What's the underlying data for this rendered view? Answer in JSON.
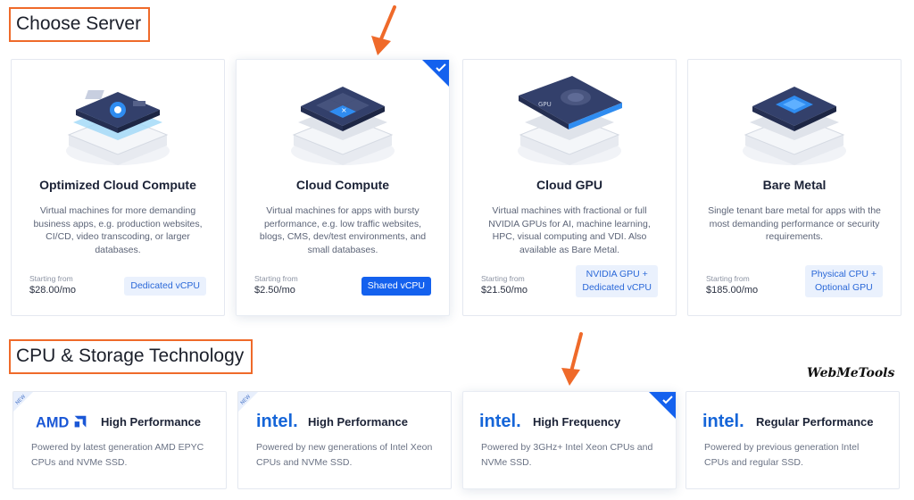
{
  "sections": {
    "server_title": "Choose Server",
    "cpu_title": "CPU & Storage Technology"
  },
  "servers": [
    {
      "name": "Optimized Cloud Compute",
      "description": "Virtual machines for more demanding business apps, e.g. production websites, CI/CD, video transcoding, or larger databases.",
      "price_label": "Starting from",
      "price": "$28.00/mo",
      "badge": "Dedicated vCPU",
      "icon": "optimized-compute-icon",
      "selected": false
    },
    {
      "name": "Cloud Compute",
      "description": "Virtual machines for apps with bursty performance, e.g. low traffic websites, blogs, CMS, dev/test environments, and small databases.",
      "price_label": "Starting from",
      "price": "$2.50/mo",
      "badge": "Shared vCPU",
      "icon": "cloud-compute-icon",
      "selected": true
    },
    {
      "name": "Cloud GPU",
      "description": "Virtual machines with fractional or full NVIDIA GPUs for AI, machine learning, HPC, visual computing and VDI. Also available as Bare Metal.",
      "price_label": "Starting from",
      "price": "$21.50/mo",
      "badge_line1": "NVIDIA GPU +",
      "badge_line2": "Dedicated vCPU",
      "icon": "gpu-icon",
      "selected": false
    },
    {
      "name": "Bare Metal",
      "description": "Single tenant bare metal for apps with the most demanding performance or security requirements.",
      "price_label": "Starting from",
      "price": "$185.00/mo",
      "badge_line1": "Physical CPU +",
      "badge_line2": "Optional GPU",
      "icon": "bare-metal-icon",
      "selected": false
    }
  ],
  "cpu_options": [
    {
      "brand": "AMD",
      "title": "High Performance",
      "description": "Powered by latest generation AMD EPYC CPUs and NVMe SSD.",
      "new_tag": "NEW",
      "selected": false
    },
    {
      "brand": "intel.",
      "title": "High Performance",
      "description": "Powered by new generations of Intel Xeon CPUs and NVMe SSD.",
      "new_tag": "NEW",
      "selected": false
    },
    {
      "brand": "intel.",
      "title": "High Frequency",
      "description": "Powered by 3GHz+ Intel Xeon CPUs and NVMe SSD.",
      "selected": true
    },
    {
      "brand": "intel.",
      "title": "Regular Performance",
      "description": "Powered by previous generation Intel CPUs and regular SSD.",
      "selected": false
    }
  ],
  "watermark": "WebMeTools",
  "colors": {
    "accent": "#1461ee",
    "highlight_border": "#ef6a2a",
    "arrow": "#ef6a2a",
    "amd_blue": "#1a57d6",
    "intel_blue": "#1565d8"
  }
}
